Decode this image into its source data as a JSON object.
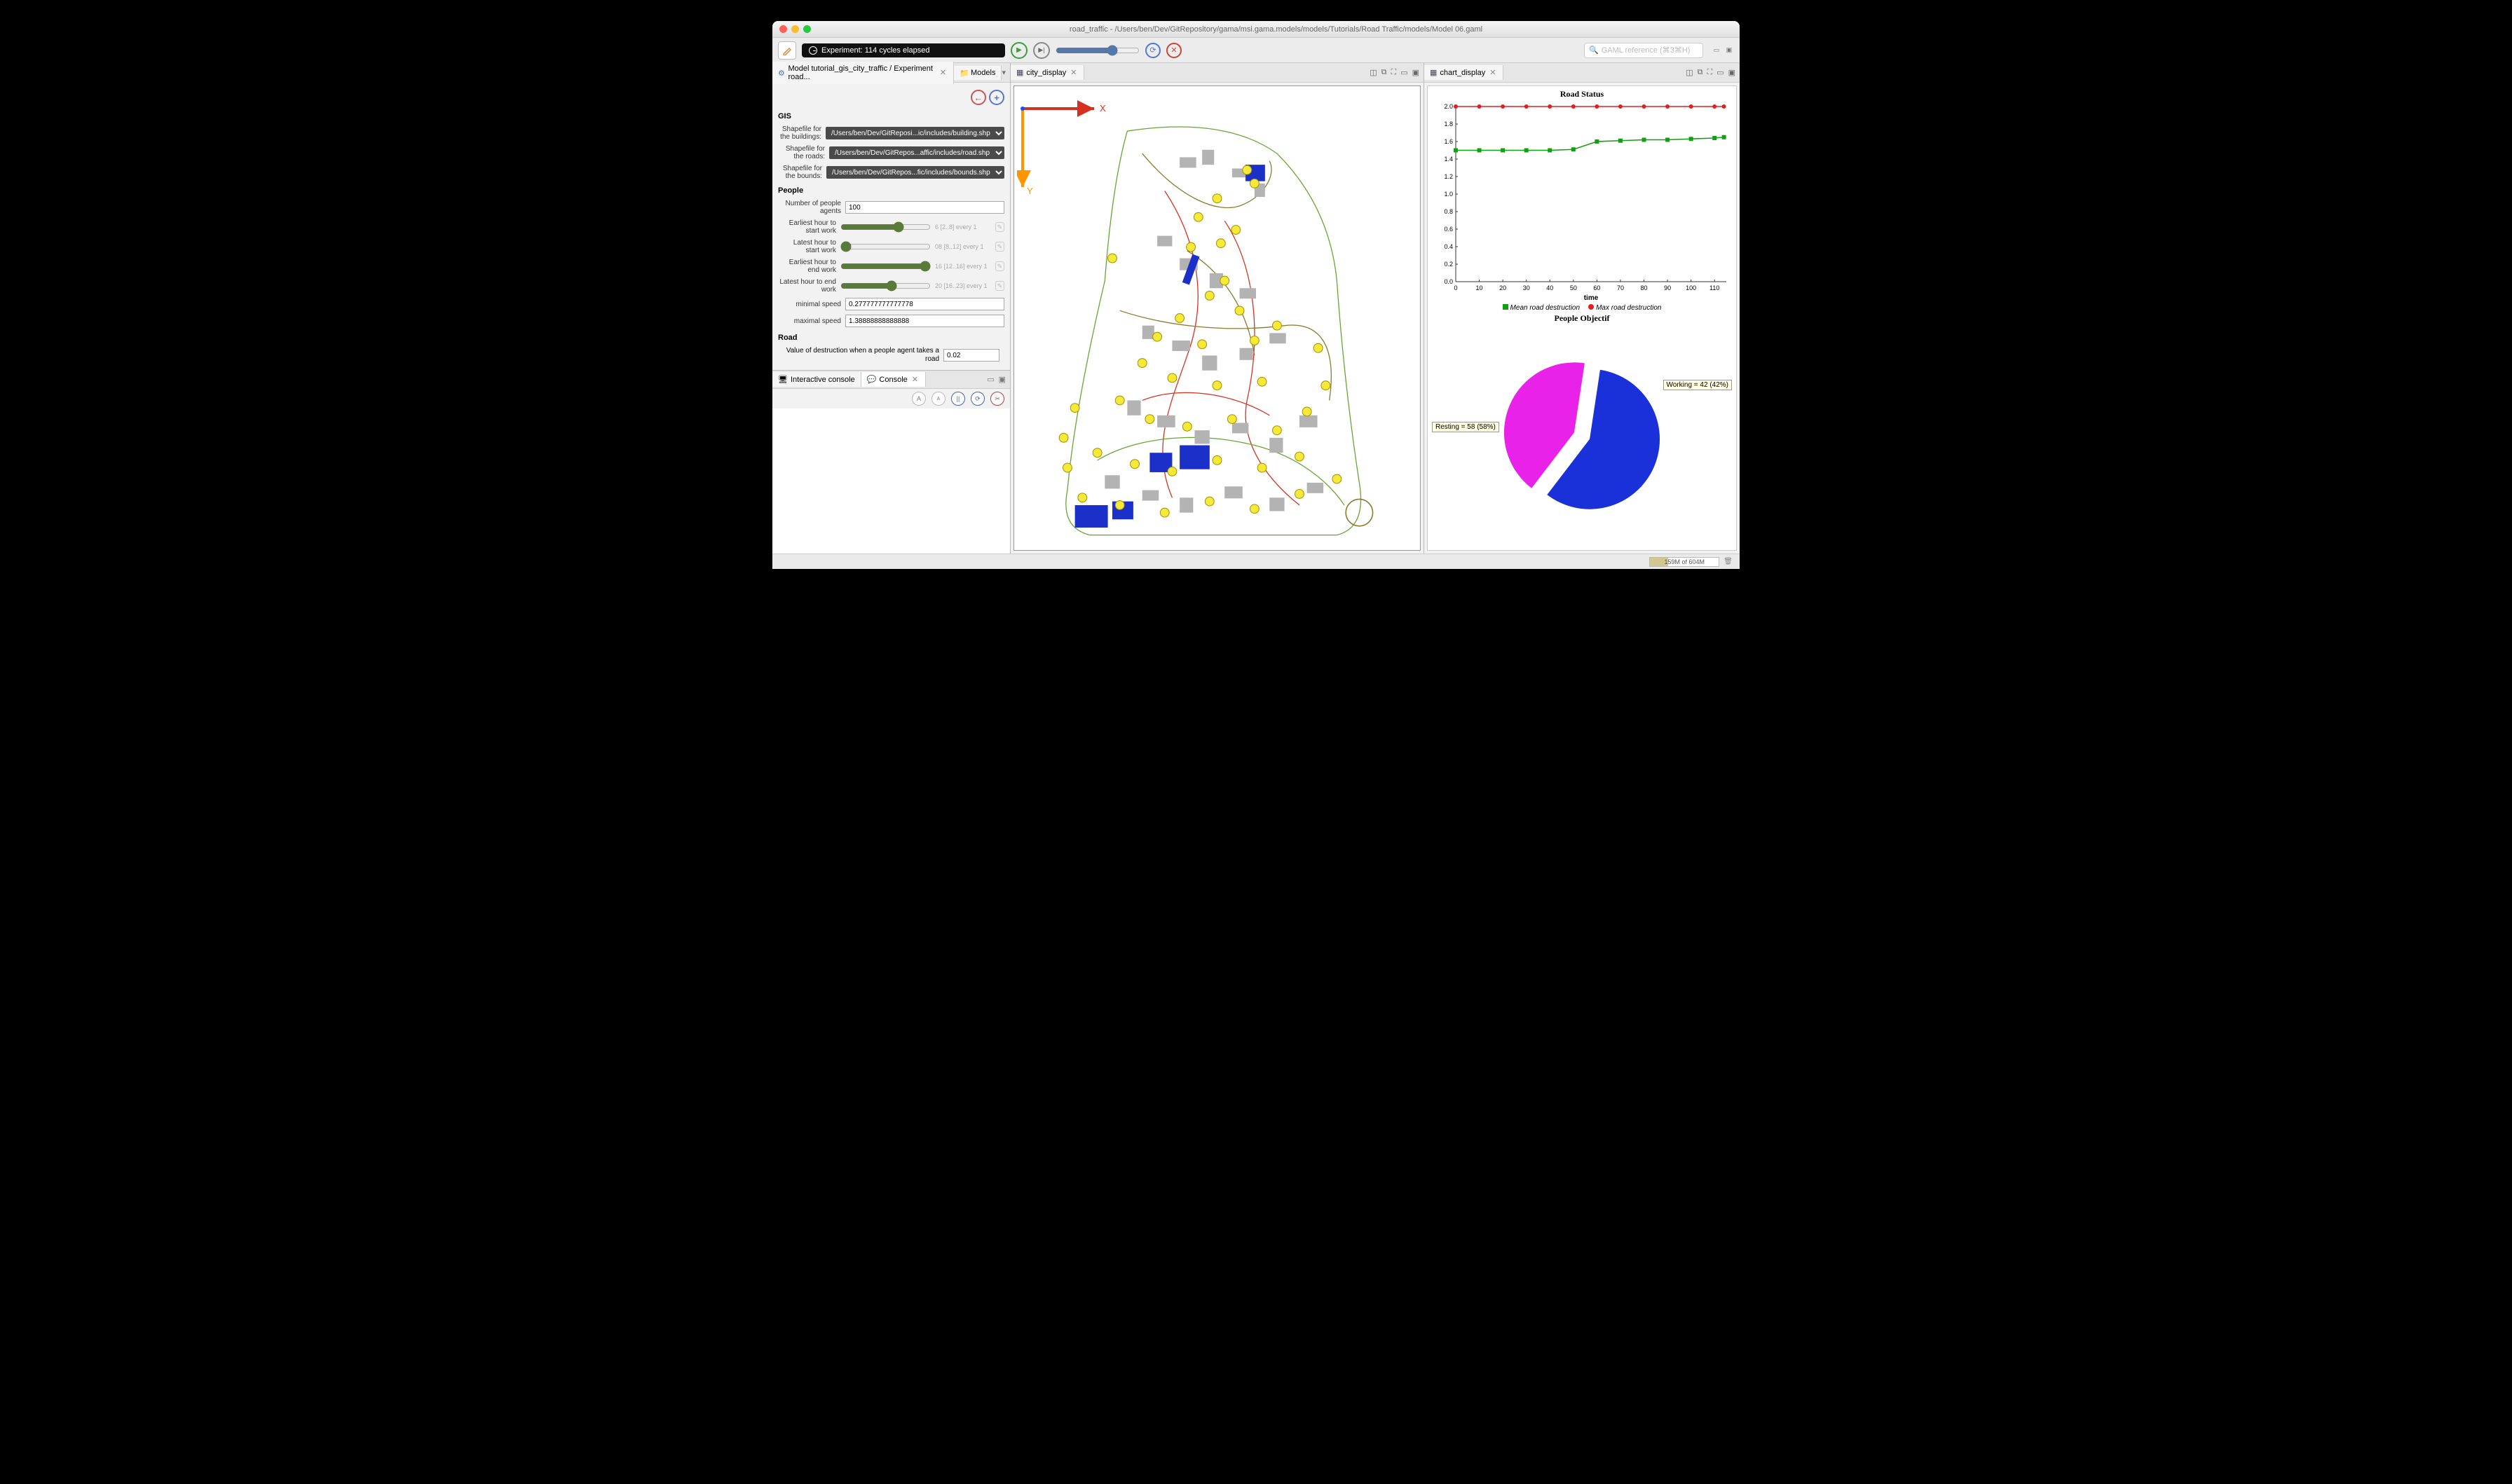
{
  "window": {
    "title": "road_traffic - /Users/ben/Dev/GitRepository/gama/msi.gama.models/models/Tutorials/Road Traffic/models/Model 06.gaml",
    "experiment_status": "Experiment: 114 cycles elapsed",
    "search_placeholder": "GAML reference (⌘3⌘H)"
  },
  "left": {
    "tab1": "Model tutorial_gis_city_traffic / Experiment road...",
    "tab2": "Models",
    "sections": {
      "gis": {
        "title": "GIS",
        "buildings_label": "Shapefile for the buildings:",
        "buildings_value": "/Users/ben/Dev/GitReposi...ic/includes/building.shp",
        "roads_label": "Shapefile for the roads:",
        "roads_value": "/Users/ben/Dev/GitRepos...affic/includes/road.shp",
        "bounds_label": "Shapefile for the bounds:",
        "bounds_value": "/Users/ben/Dev/GitRepos...fic/includes/bounds.shp"
      },
      "people": {
        "title": "People",
        "n_agents_label": "Number of people agents",
        "n_agents": "100",
        "earliest_start_label": "Earliest hour to start work",
        "earliest_start_hint": "6 [2..8] every 1",
        "latest_start_label": "Latest hour to start work",
        "latest_start_hint": "08 [8..12] every 1",
        "earliest_end_label": "Earliest hour to end work",
        "earliest_end_hint": "16 [12..16] every 1",
        "latest_end_label": "Latest hour to end work",
        "latest_end_hint": "20 [16..23] every 1",
        "min_speed_label": "minimal speed",
        "min_speed": "0.277777777777778",
        "max_speed_label": "maximal speed",
        "max_speed": "1.38888888888888"
      },
      "road": {
        "title": "Road",
        "destruction_label": "Value of destruction when a people agent takes a road",
        "destruction_value": "0.02"
      }
    },
    "console_tab1": "Interactive console",
    "console_tab2": "Console"
  },
  "center": {
    "tab": "city_display"
  },
  "right": {
    "tab": "chart_display",
    "road_title": "Road Status",
    "road_xlabel": "time",
    "legend_mean": "Mean road destruction",
    "legend_max": "Max road destruction",
    "pie_title": "People Objectif",
    "pie_resting": "Resting = 58 (58%)",
    "pie_working": "Working = 42 (42%)"
  },
  "status": {
    "memory": "159M of 604M"
  },
  "chart_data": [
    {
      "type": "line",
      "title": "Road Status",
      "xlabel": "time",
      "ylabel": "",
      "xlim": [
        0,
        115
      ],
      "ylim": [
        0.0,
        2.0
      ],
      "x_ticks": [
        0,
        10,
        20,
        30,
        40,
        50,
        60,
        70,
        80,
        90,
        100,
        110
      ],
      "y_ticks": [
        0.0,
        0.2,
        0.4,
        0.6,
        0.8,
        1.0,
        1.2,
        1.4,
        1.6,
        1.8,
        2.0
      ],
      "series": [
        {
          "name": "Max road destruction",
          "color": "#e02020",
          "x": [
            0,
            10,
            20,
            30,
            40,
            50,
            60,
            70,
            80,
            90,
            100,
            110,
            114
          ],
          "y": [
            2.0,
            2.0,
            2.0,
            2.0,
            2.0,
            2.0,
            2.0,
            2.0,
            2.0,
            2.0,
            2.0,
            2.0,
            2.0
          ]
        },
        {
          "name": "Mean road destruction",
          "color": "#11a011",
          "x": [
            0,
            10,
            20,
            30,
            40,
            50,
            60,
            70,
            80,
            90,
            100,
            110,
            114
          ],
          "y": [
            1.5,
            1.5,
            1.5,
            1.5,
            1.5,
            1.51,
            1.6,
            1.61,
            1.62,
            1.62,
            1.63,
            1.64,
            1.65
          ]
        }
      ]
    },
    {
      "type": "pie",
      "title": "People Objectif",
      "slices": [
        {
          "name": "Resting",
          "value": 58,
          "percent": 58,
          "color": "#1a30d8"
        },
        {
          "name": "Working",
          "value": 42,
          "percent": 42,
          "color": "#e822e8"
        }
      ]
    }
  ]
}
